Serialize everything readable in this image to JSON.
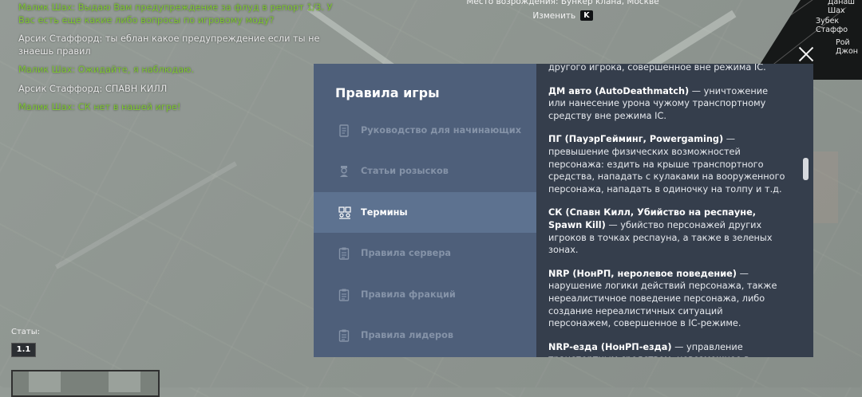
{
  "chat": [
    {
      "color": "green",
      "text": "Малик Шах: Выдаю Вам предупреждение за флуд в репорт 1/3. У Вас есть еще какие либо вопросы по игровому моду?"
    },
    {
      "color": "gray",
      "text": "Арсик Стаффорд: ты еблан какое предупреждение если ты не знаешь правил"
    },
    {
      "color": "green",
      "text": "Малик Шах: Ожидайте, я наблюдаю."
    },
    {
      "color": "gray",
      "text": "Арсик Стаффорд: СПАВН КИЛЛ"
    },
    {
      "color": "green",
      "text": "Малик Шах: СК нет в нашей игре!"
    }
  ],
  "spawn": {
    "place": "Место возрождения: Бункер клана, Москве",
    "change_label": "Изменить",
    "change_key": "K"
  },
  "minimap": {
    "labels": [
      "Зубек Стаффо",
      "Рой Джон",
      "Данаш Шах"
    ]
  },
  "modal": {
    "title": "Правила игры",
    "nav": [
      {
        "label": "Руководство для начинающих",
        "icon": "scroll-icon",
        "active": false
      },
      {
        "label": "Статьи розысков",
        "icon": "officer-icon",
        "active": false
      },
      {
        "label": "Термины",
        "icon": "people-icon",
        "active": true
      },
      {
        "label": "Правила сервера",
        "icon": "clipboard-icon",
        "active": false
      },
      {
        "label": "Правила фракций",
        "icon": "clipboard-icon",
        "active": false
      },
      {
        "label": "Правила лидеров",
        "icon": "clipboard-icon",
        "active": false
      }
    ],
    "content": [
      {
        "term": "",
        "text": "другого игрока, совершенное вне режима IC."
      },
      {
        "term": "ДМ авто (AutoDeathmatch)",
        "text": " — уничтожение или нанесение урона чужому транспортному средству вне режима IC."
      },
      {
        "term": "ПГ (ПауэрГейминг, Powergaming)",
        "text": " — превышение физических возможностей персонажа: ездить на крыше транспортного средства, нападать с кулаками на вооруженного персонажа, нападать в одиночку на толпу и т.д."
      },
      {
        "term": "СК (Спавн Килл, Убийство на респауне, Spawn Kill)",
        "text": " — убийство персонажей других игроков в точках респауна, а также в зеленых зонах."
      },
      {
        "term": "NRP (НонРП, неролевое поведение)",
        "text": " — нарушение логики действий персонажа, также нереалистичное поведение персонажа, либо создание нереалистичных ситуаций персонажем, совершенное в IC-режиме."
      },
      {
        "term": "NRP-езда (НонРП-езда)",
        "text": " — управление транспортным средством, невозможное в реальной"
      }
    ]
  },
  "hud": {
    "stats_label": "Статы:",
    "stats_value": "1.1"
  }
}
